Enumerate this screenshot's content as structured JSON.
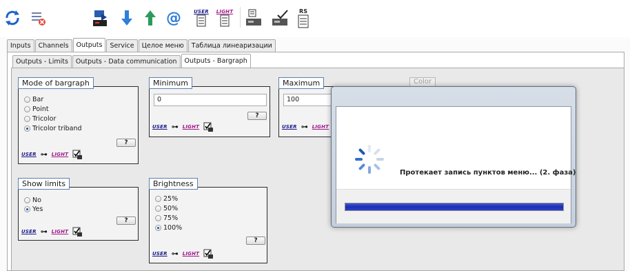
{
  "main_tabs": [
    "Inputs",
    "Channels",
    "Outputs",
    "Service",
    "Целое меню",
    "Таблица линеаризации"
  ],
  "active_main_tab": "Outputs",
  "sub_tabs": [
    "Outputs - Limits",
    "Outputs - Data communication",
    "Outputs - Bargraph"
  ],
  "active_sub_tab": "Outputs - Bargraph",
  "toolbar": {
    "user_label": "USER",
    "light_label": "LIGHT",
    "rs_label": "RS"
  },
  "mode_of_bargraph": {
    "title": "Mode of bargraph",
    "options": [
      "Bar",
      "Point",
      "Tricolor",
      "Tricolor triband"
    ],
    "selected": "Tricolor triband",
    "help": "?"
  },
  "minimum": {
    "title": "Minimum",
    "value": "0",
    "help": "?"
  },
  "maximum": {
    "title": "Maximum",
    "value": "100"
  },
  "color": {
    "title": "Color"
  },
  "show_limits": {
    "title": "Show limits",
    "options": [
      "No",
      "Yes"
    ],
    "selected": "Yes",
    "help": "?"
  },
  "brightness": {
    "title": "Brightness",
    "options": [
      "25%",
      "50%",
      "75%",
      "100%"
    ],
    "selected": "100%",
    "help": "?"
  },
  "perm": {
    "user": "USER",
    "light": "LIGHT"
  },
  "dialog": {
    "message": "Протекает запись пунктов меню... (2. фаза)",
    "progress": 1.0
  },
  "colors": {
    "progress": "#2b42c8",
    "user_tag": "#1a1a8c",
    "light_tag": "#a0168a",
    "radio_checked": "#1c4fa8"
  }
}
